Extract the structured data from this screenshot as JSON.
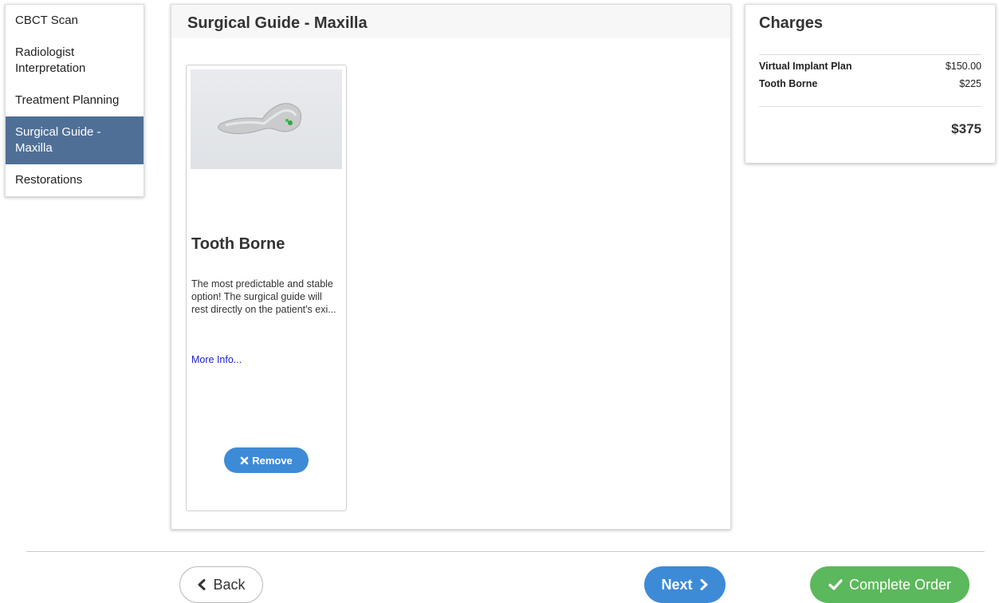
{
  "sidebar": {
    "items": [
      {
        "label": "CBCT Scan"
      },
      {
        "label": "Radiologist Interpretation"
      },
      {
        "label": "Treatment Planning"
      },
      {
        "label": "Surgical Guide - Maxilla",
        "active": true
      },
      {
        "label": "Restorations"
      }
    ]
  },
  "main": {
    "title": "Surgical Guide - Maxilla",
    "product": {
      "title": "Tooth Borne",
      "description": "The most predictable and stable option! The surgical guide will rest directly on the patient's exi...",
      "more_info": "More Info...",
      "remove_label": "Remove"
    }
  },
  "charges": {
    "title": "Charges",
    "items": [
      {
        "label": "Virtual Implant Plan",
        "amount": "$150.00"
      },
      {
        "label": "Tooth Borne",
        "amount": "$225"
      }
    ],
    "total": "$375"
  },
  "footer": {
    "back_label": "Back",
    "next_label": "Next",
    "complete_label": "Complete Order"
  },
  "colors": {
    "sidebar_active": "#4f6f96",
    "primary_blue": "#3d8bd6",
    "success_green": "#5cb85c",
    "link_blue": "#1b1bd9"
  },
  "icons": {
    "remove": "close-icon",
    "back": "chevron-left-icon",
    "next": "chevron-right-icon",
    "complete": "check-icon"
  }
}
